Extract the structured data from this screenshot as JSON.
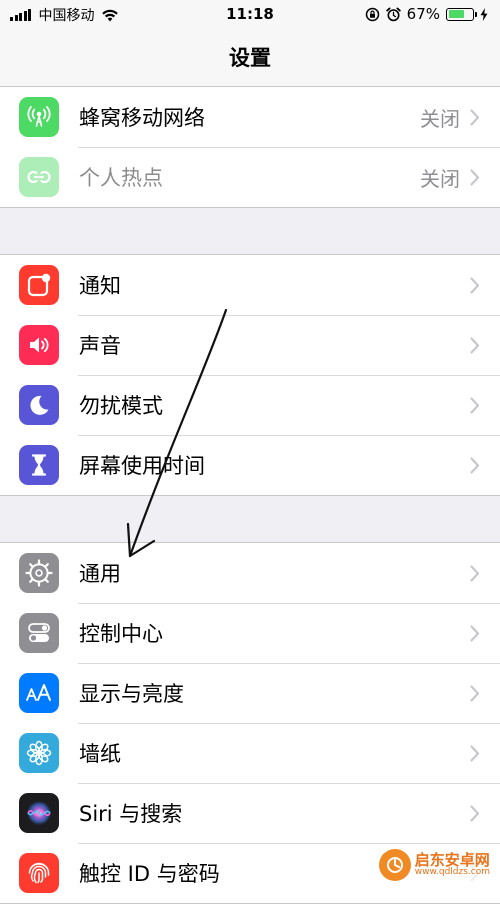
{
  "status_bar": {
    "carrier": "中国移动",
    "time": "11:18",
    "battery_percent": "67%",
    "battery_level": 0.67,
    "battery_color": "#4cd964"
  },
  "nav": {
    "title": "设置"
  },
  "groups": [
    {
      "items": [
        {
          "label": "蜂窝移动网络",
          "value": "关闭",
          "icon": "antenna-icon",
          "icon_color": "#4cd964",
          "dim": false
        },
        {
          "label": "个人热点",
          "value": "关闭",
          "icon": "hotspot-icon",
          "icon_color": "#4cd964",
          "dim": true
        }
      ]
    },
    {
      "items": [
        {
          "label": "通知",
          "icon": "notifications-icon",
          "icon_color": "#ff3b30"
        },
        {
          "label": "声音",
          "icon": "speaker-icon",
          "icon_color": "#ff2d55"
        },
        {
          "label": "勿扰模式",
          "icon": "moon-icon",
          "icon_color": "#5856d6"
        },
        {
          "label": "屏幕使用时间",
          "icon": "hourglass-icon",
          "icon_color": "#5856d6"
        }
      ]
    },
    {
      "items": [
        {
          "label": "通用",
          "icon": "gear-icon",
          "icon_color": "#8e8e93"
        },
        {
          "label": "控制中心",
          "icon": "toggles-icon",
          "icon_color": "#8e8e93"
        },
        {
          "label": "显示与亮度",
          "icon": "text-size-icon",
          "icon_color": "#007aff"
        },
        {
          "label": "墙纸",
          "icon": "flower-icon",
          "icon_color": "#34aadc"
        },
        {
          "label": "Siri 与搜索",
          "icon": "siri-icon",
          "icon_color": "#1c1c1e"
        },
        {
          "label": "触控 ID 与密码",
          "icon": "fingerprint-icon",
          "icon_color": "#ff3b30"
        }
      ]
    }
  ],
  "watermark": {
    "name": "启东安卓网",
    "url": "www.qdldzs.com"
  }
}
